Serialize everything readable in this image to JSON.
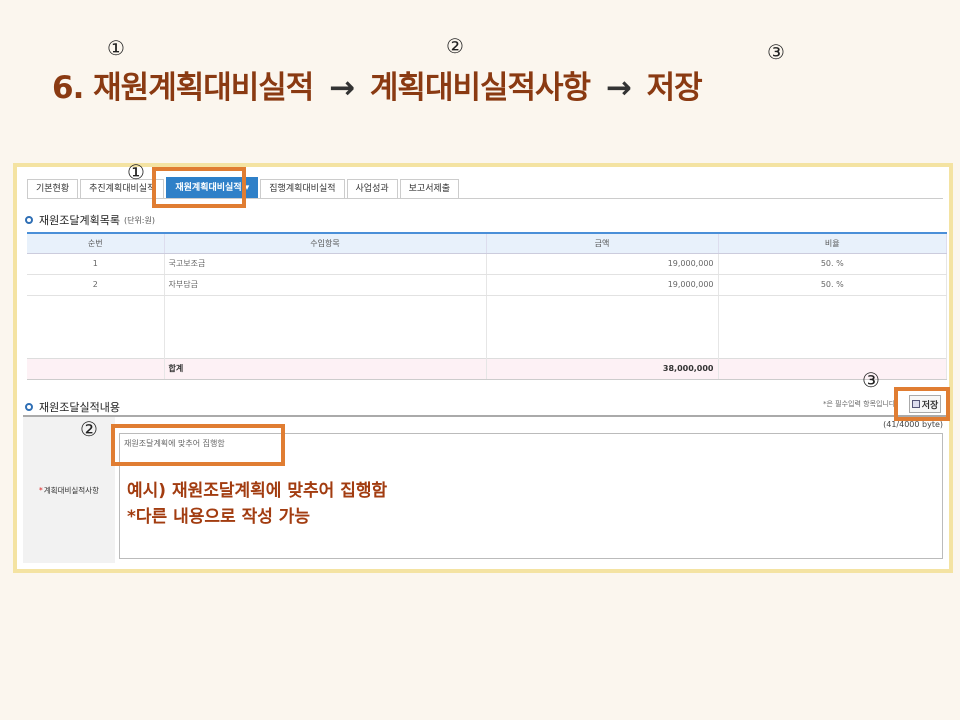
{
  "title": {
    "step_number": "6.",
    "step1": "재원계획대비실적",
    "arrow": "→",
    "step2": "계획대비실적사항",
    "step3": "저장",
    "markers": [
      "①",
      "②",
      "③"
    ]
  },
  "tabs": [
    {
      "label": "기본현황"
    },
    {
      "label": "추진계획대비실적"
    },
    {
      "label": "재원계획대비실적 ▾",
      "active": true
    },
    {
      "label": "집행계획대비실적"
    },
    {
      "label": "사업성과"
    },
    {
      "label": "보고서제출"
    }
  ],
  "plan_section": {
    "title": "재원조달계획목록",
    "unit": "(단위:원)",
    "columns": [
      "순번",
      "수입항목",
      "금액",
      "비율"
    ],
    "rows": [
      [
        "1",
        "국고보조금",
        "19,000,000",
        "50. %"
      ],
      [
        "2",
        "자부담금",
        "19,000,000",
        "50. %"
      ]
    ],
    "total_label": "합계",
    "total_amount": "38,000,000"
  },
  "result_section": {
    "title": "재원조달실적내용",
    "required_hint": "*은 필수입력 항목입니다",
    "save_label": "저장",
    "field_label": "계획대비실적사항",
    "field_value": "재원조달계획에 맞추어 집행함",
    "byte_count": "(41/4000 byte)"
  },
  "annotations": {
    "markers": [
      "①",
      "②",
      "③"
    ],
    "example_line1": "예시) 재원조달계획에 맞추어 집행함",
    "example_line2": "*다른 내용으로 작성 가능"
  },
  "colors": {
    "accent": "#2f80c8",
    "highlight": "#e07d32",
    "title": "#8a3a12",
    "frame": "#f4e3a2"
  }
}
